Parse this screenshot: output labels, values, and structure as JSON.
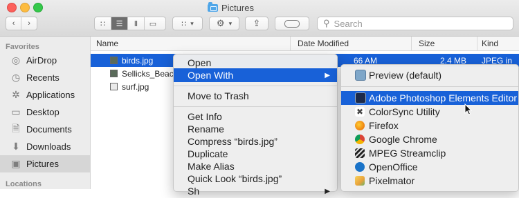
{
  "window": {
    "title": "Pictures"
  },
  "toolbar": {
    "back_icon": "chevron-left",
    "forward_icon": "chevron-right",
    "views": [
      "icon-view",
      "list-view",
      "column-view",
      "gallery-view"
    ],
    "search_placeholder": "Search"
  },
  "sidebar": {
    "favorites_label": "Favorites",
    "locations_label": "Locations",
    "items": [
      {
        "label": "AirDrop",
        "icon": "airdrop-icon"
      },
      {
        "label": "Recents",
        "icon": "clock-icon"
      },
      {
        "label": "Applications",
        "icon": "applications-icon"
      },
      {
        "label": "Desktop",
        "icon": "desktop-icon"
      },
      {
        "label": "Documents",
        "icon": "document-icon"
      },
      {
        "label": "Downloads",
        "icon": "download-icon"
      },
      {
        "label": "Pictures",
        "icon": "camera-icon",
        "selected": true
      }
    ]
  },
  "filelist": {
    "columns": {
      "name": "Name",
      "date": "Date Modified",
      "size": "Size",
      "kind": "Kind"
    },
    "rows": [
      {
        "name": "birds.jpg",
        "date": "66 AM",
        "size": "2.4 MB",
        "kind": "JPEG in",
        "selected": true
      },
      {
        "name": "Sellicks_Beach",
        "date": "",
        "size": "",
        "kind": ""
      },
      {
        "name": "surf.jpg",
        "date": "",
        "size": "",
        "kind": ""
      }
    ]
  },
  "context_menu": {
    "open": "Open",
    "open_with": "Open With",
    "move_to_trash": "Move to Trash",
    "get_info": "Get Info",
    "rename": "Rename",
    "compress": "Compress “birds.jpg”",
    "duplicate": "Duplicate",
    "make_alias": "Make Alias",
    "quick_look": "Quick Look “birds.jpg”",
    "share": "Sh"
  },
  "open_with_menu": {
    "items": [
      {
        "label": "Preview (default)",
        "icon": "preview-icon",
        "color": "#7fa7c9"
      },
      {
        "label": "Adobe Photoshop Elements Editor",
        "icon": "photoshop-elements-icon",
        "color": "#1c2a4a"
      },
      {
        "label": "ColorSync Utility",
        "icon": "colorsync-icon",
        "color": "#444444"
      },
      {
        "label": "Firefox",
        "icon": "firefox-icon",
        "color": "#e66000"
      },
      {
        "label": "Google Chrome",
        "icon": "chrome-icon",
        "color": "#4285f4"
      },
      {
        "label": "MPEG Streamclip",
        "icon": "clapperboard-icon",
        "color": "#222222"
      },
      {
        "label": "OpenOffice",
        "icon": "openoffice-icon",
        "color": "#1a73c8"
      },
      {
        "label": "Pixelmator",
        "icon": "pixelmator-icon",
        "color": "#e8a23a"
      }
    ]
  },
  "colors": {
    "selection": "#1861d8"
  }
}
